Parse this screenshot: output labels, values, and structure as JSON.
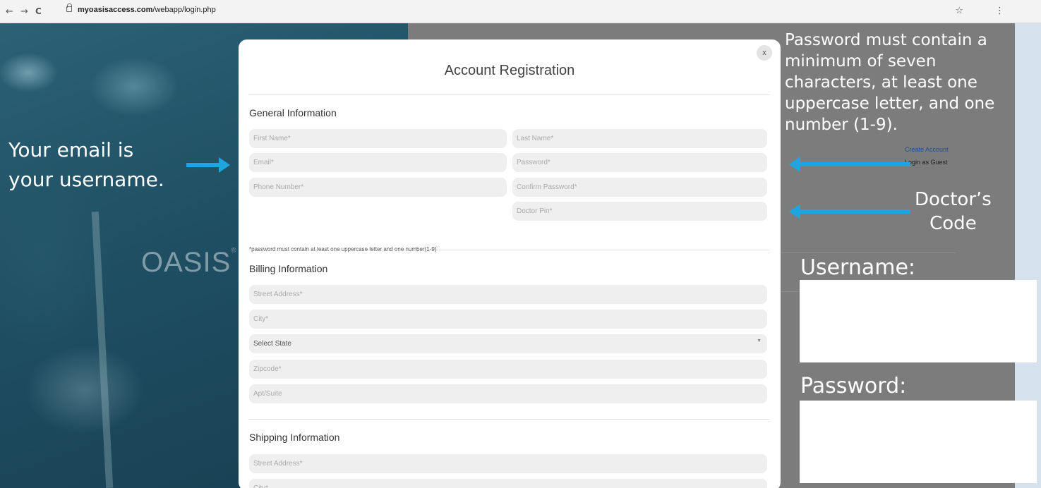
{
  "browser": {
    "back": "←",
    "forward": "→",
    "reload": "C",
    "url_domain": "myoasisaccess.com",
    "url_path": "/webapp/login.php",
    "star": "☆",
    "menu": "⋮"
  },
  "background": {
    "logo": "OASIS",
    "create_account": "Create Account",
    "login_as_guest": "Login as Guest"
  },
  "modal": {
    "close": "x",
    "title": "Account Registration",
    "general": {
      "heading": "General Information",
      "first_name": "First Name*",
      "last_name": "Last Name*",
      "email": "Email*",
      "password": "Password*",
      "phone": "Phone Number*",
      "confirm_password": "Confirm Password*",
      "doctor_pin": "Doctor Pin*",
      "note": "*password must contain at least one uppercase letter and one number(1-9)"
    },
    "billing": {
      "heading": "Billing Information",
      "street": "Street Address*",
      "city": "City*",
      "state": "Select State",
      "zip": "Zipcode*",
      "apt": "Apt/Suite"
    },
    "shipping": {
      "heading": "Shipping Information",
      "street": "Street Address*",
      "city": "City*"
    }
  },
  "annotations": {
    "email_line1": "Your email is",
    "email_line2": "your username.",
    "password_rule": "Password must contain a minimum of seven characters, at least one uppercase letter, and one number (1-9).",
    "doctor_line1": "Doctor’s",
    "doctor_line2": "Code",
    "username_label": "Username:",
    "password_label": "Password:",
    "arrow_color": "#1ea5e0"
  }
}
